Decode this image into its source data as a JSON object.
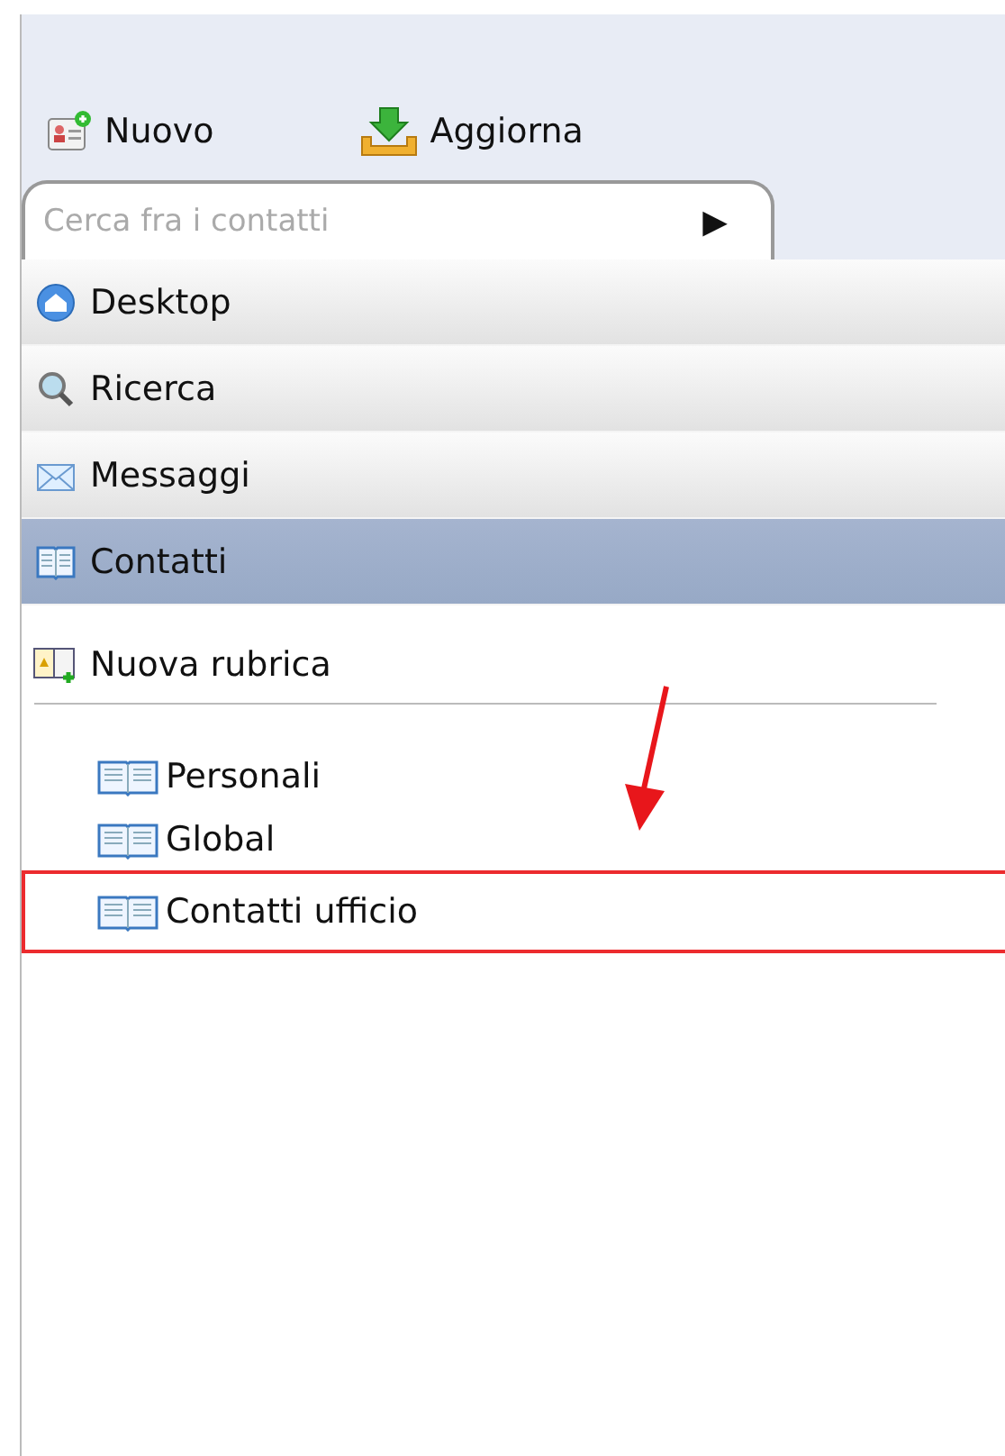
{
  "toolbar": [
    {
      "kind": "new",
      "label": "Nuovo"
    },
    {
      "kind": "refresh",
      "label": "Aggiorna"
    }
  ],
  "search": {
    "placeholder": "Cerca fra i contatti",
    "button": "▶"
  },
  "nav": [
    {
      "kind": "desktop",
      "label": "Desktop",
      "selected": false
    },
    {
      "kind": "search",
      "label": "Ricerca",
      "selected": false
    },
    {
      "kind": "mail",
      "label": "Messaggi",
      "selected": false
    },
    {
      "kind": "book",
      "label": "Contatti",
      "selected": true
    }
  ],
  "new_addressbook": "Nuova rubrica",
  "addressbooks": [
    {
      "label": "Personali",
      "highlighted": false
    },
    {
      "label": "Global",
      "highlighted": false
    },
    {
      "label": "Contatti ufficio",
      "highlighted": true
    }
  ]
}
